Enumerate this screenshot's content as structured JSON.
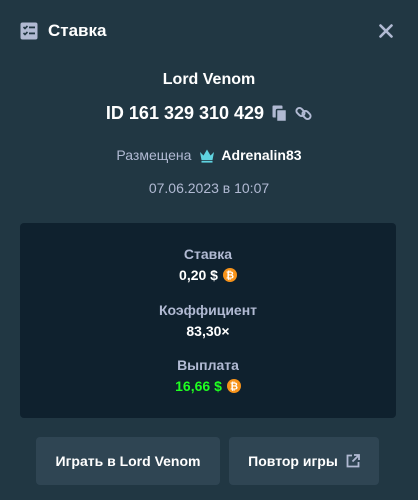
{
  "header": {
    "title": "Ставка",
    "icon": "bet-slip-icon",
    "close_icon": "close-icon"
  },
  "bet": {
    "game_name": "Lord Venom",
    "id_label": "ID 161 329 310 429",
    "placed_label": "Размещена",
    "username": "Adrenalin83",
    "datetime": "07.06.2023 в 10:07"
  },
  "stats": {
    "bet_label": "Ставка",
    "bet_value": "0,20 $",
    "multiplier_label": "Коэффициент",
    "multiplier_value": "83,30×",
    "payout_label": "Выплата",
    "payout_value": "16,66 $"
  },
  "buttons": {
    "play_label": "Играть в Lord Venom",
    "replay_label": "Повтор игры"
  },
  "colors": {
    "background": "#213743",
    "stats_background": "#0f212e",
    "button_background": "#2f4553",
    "muted_text": "#b1bad3",
    "payout_green": "#1fff20",
    "coin_orange": "#f7931a",
    "vip_cyan": "#5fd3e0"
  }
}
